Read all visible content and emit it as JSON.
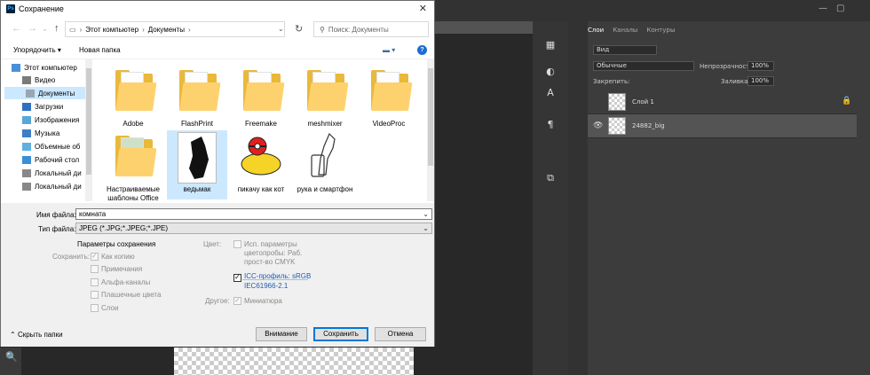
{
  "dialog": {
    "title": "Сохранение",
    "breadcrumb": [
      "Этот компьютер",
      "Документы"
    ],
    "search_placeholder": "Поиск: Документы",
    "toolbar": {
      "organize": "Упорядочить ▾",
      "new_folder": "Новая папка"
    },
    "sidebar": [
      {
        "label": "Этот компьютер",
        "icon": "computer-icon",
        "selected": false
      },
      {
        "label": "Видео",
        "icon": "video-icon",
        "selected": false
      },
      {
        "label": "Документы",
        "icon": "documents-icon",
        "selected": true
      },
      {
        "label": "Загрузки",
        "icon": "download-icon",
        "selected": false
      },
      {
        "label": "Изображения",
        "icon": "pictures-icon",
        "selected": false
      },
      {
        "label": "Музыка",
        "icon": "music-icon",
        "selected": false
      },
      {
        "label": "Объемные об",
        "icon": "3d-objects-icon",
        "selected": false
      },
      {
        "label": "Рабочий стол",
        "icon": "desktop-icon",
        "selected": false
      },
      {
        "label": "Локальный ди",
        "icon": "drive-icon",
        "selected": false
      },
      {
        "label": "Локальный ди",
        "icon": "drive-icon",
        "selected": false
      }
    ],
    "files": [
      {
        "label": "Adobe",
        "kind": "folder"
      },
      {
        "label": "FlashPrint",
        "kind": "folder"
      },
      {
        "label": "Freemake",
        "kind": "folder"
      },
      {
        "label": "meshmixer",
        "kind": "folder"
      },
      {
        "label": "VideoProc",
        "kind": "folder"
      },
      {
        "label": "Настраиваемые шаблоны Office",
        "kind": "folder"
      },
      {
        "label": "ведьмак",
        "kind": "image",
        "selected": true
      },
      {
        "label": "пикачу как кот",
        "kind": "image"
      },
      {
        "label": "рука и смартфон",
        "kind": "image"
      }
    ],
    "filename_label": "Имя файла:",
    "filename_value": "комната",
    "filetype_label": "Тип файла:",
    "filetype_value": "JPEG (*.JPG;*.JPEG;*.JPE)",
    "save_params_title": "Параметры сохранения",
    "save_label": "Сохранить:",
    "save_options": [
      {
        "label": "Как копию",
        "checked": true
      },
      {
        "label": "Примечания",
        "checked": false
      },
      {
        "label": "Альфа-каналы",
        "checked": false
      },
      {
        "label": "Плашечные цвета",
        "checked": false
      },
      {
        "label": "Слои",
        "checked": false
      }
    ],
    "color_label": "Цвет:",
    "proof_option": "Исп. параметры цветопробы: Раб. прост-во CMYK",
    "icc_option_line1": "ICC-профиль: sRGB",
    "icc_option_line2": "IEC61966-2.1",
    "other_label": "Другое:",
    "thumbnail_option": "Миниатюра",
    "hide_folders": "Скрыть папки",
    "buttons": {
      "warning": "Внимание",
      "save": "Сохранить",
      "cancel": "Отмена"
    }
  },
  "ps": {
    "panel_tabs": [
      "Слои",
      "Каналы",
      "Контуры"
    ],
    "kind_filter": "Вид",
    "blend_mode": "Обычные",
    "opacity_label": "Непрозрачность:",
    "opacity_value": "100%",
    "lock_label": "Закрепить:",
    "fill_label": "Заливка:",
    "fill_value": "100%",
    "layers": [
      {
        "name": "Слой 1",
        "visible": false,
        "locked": true
      },
      {
        "name": "24882_big",
        "visible": true,
        "locked": false
      }
    ]
  }
}
